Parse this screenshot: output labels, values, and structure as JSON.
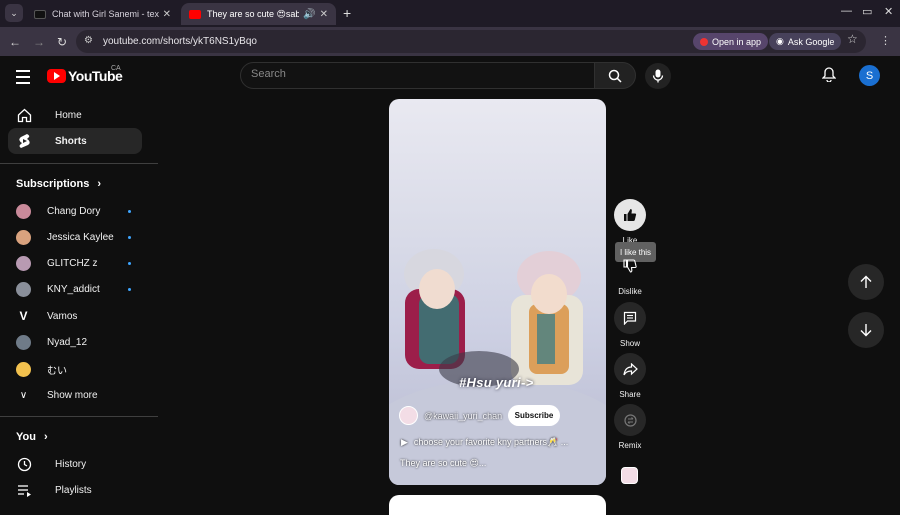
{
  "browser": {
    "tabs": [
      {
        "title": "Chat with Girl Sanemi - text or !",
        "active": false
      },
      {
        "title": "They are so cute 😍sabito",
        "active": true
      }
    ],
    "url": "youtube.com/shorts/ykT6NS1yBqo",
    "open_in_app": "Open in app",
    "ask_google": "Ask Google"
  },
  "header": {
    "logo_text": "YouTube",
    "region": "CA",
    "search_placeholder": "Search",
    "avatar_letter": "S"
  },
  "sidebar": {
    "home": "Home",
    "shorts": "Shorts",
    "subscriptions_title": "Subscriptions",
    "channels": [
      {
        "name": "Chang Dory",
        "color": "#c98a9a",
        "new": true
      },
      {
        "name": "Jessica Kaylee",
        "color": "#d9a27e",
        "new": true
      },
      {
        "name": "GLITCHZ z",
        "color": "#b89ab2",
        "new": true
      },
      {
        "name": "KNY_addict",
        "color": "#8a8f9a",
        "new": true
      },
      {
        "name": "Vamos",
        "color": "#ffffff",
        "new": false
      },
      {
        "name": "Nyad_12",
        "color": "#6f7b88",
        "new": false
      },
      {
        "name": "むい",
        "color": "#f2c14e",
        "new": false
      }
    ],
    "show_more": "Show more",
    "you_title": "You",
    "history": "History",
    "playlists": "Playlists"
  },
  "short": {
    "overlay_text": "#Hsu yuri->",
    "channel": "@kawaii_yuri_chan",
    "subscribe": "Subscribe",
    "description": "choose your favorite kny partners🥂 ...",
    "caption": "They are so cute 😍..."
  },
  "actions": {
    "like": "Like",
    "tooltip": "I like this",
    "dislike": "Dislike",
    "show": "Show",
    "share": "Share",
    "remix": "Remix"
  }
}
